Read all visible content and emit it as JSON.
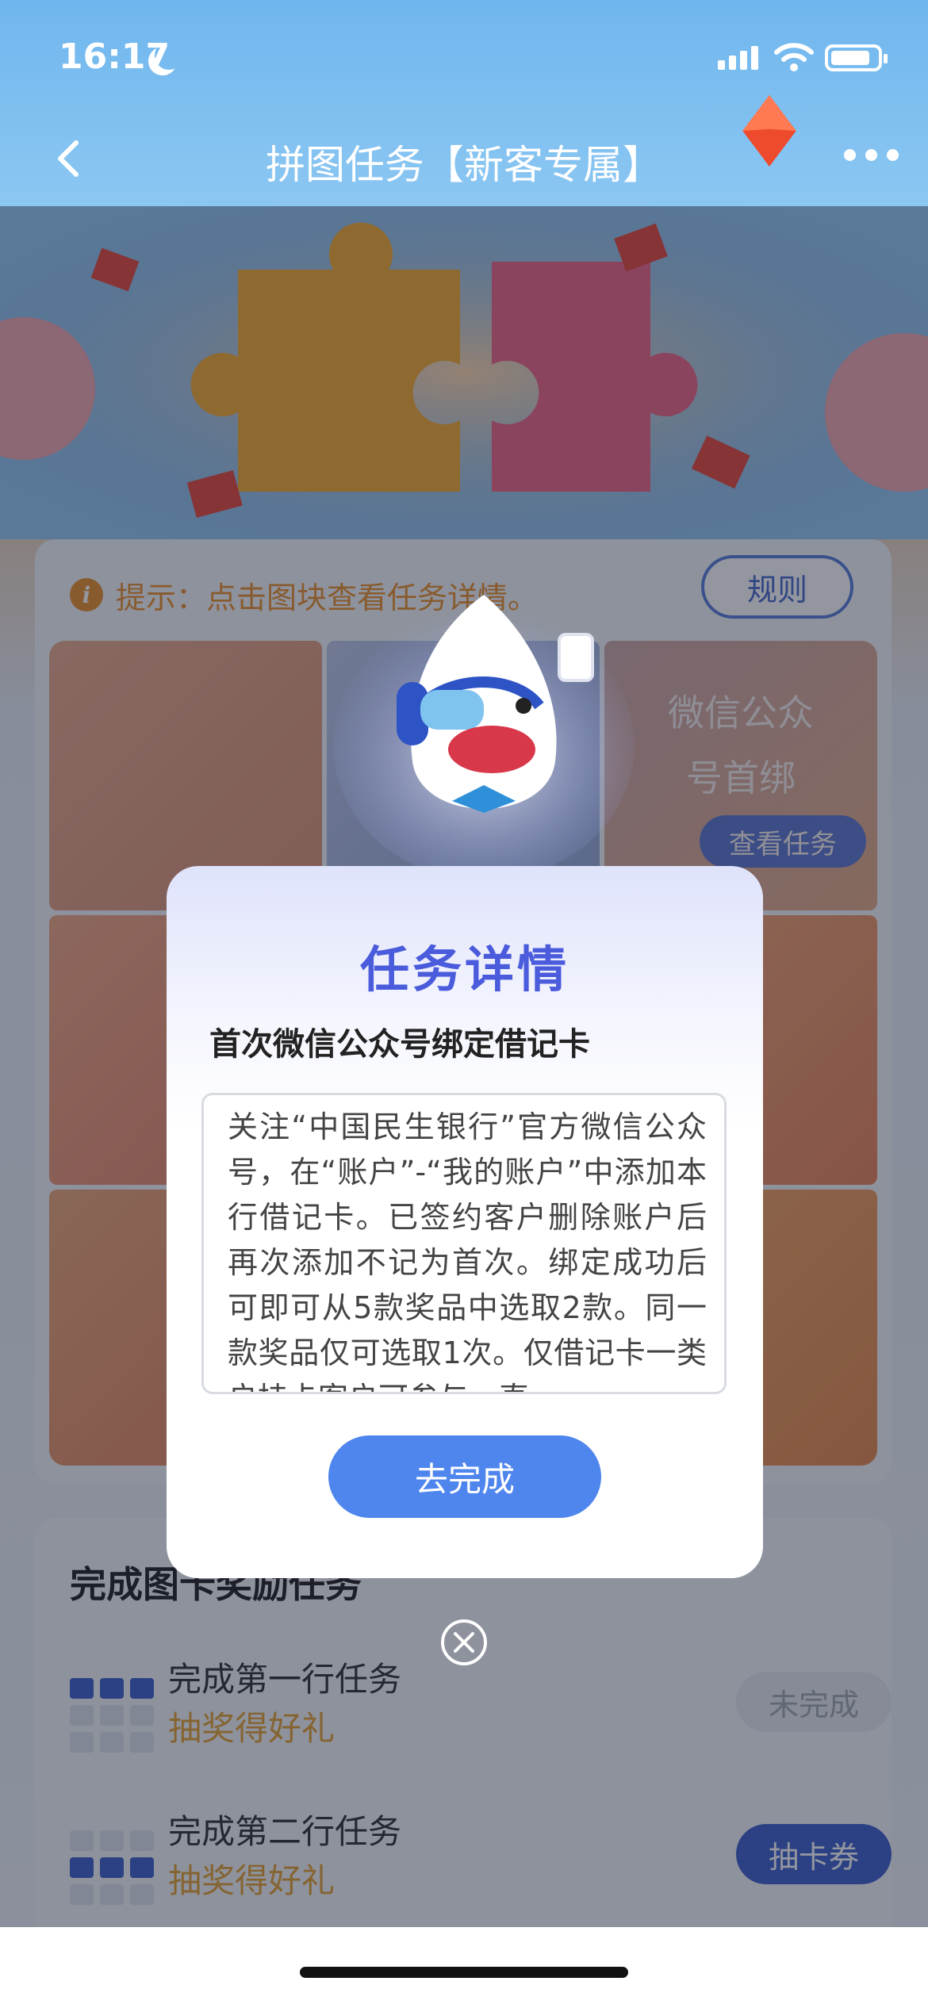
{
  "status_bar": {
    "time": "16:17"
  },
  "nav": {
    "title": "拼图任务【新客专属】"
  },
  "tip": {
    "icon": "i",
    "text": "提示：点击图块查看任务详情。",
    "rules_label": "规则"
  },
  "puzzle_grid": {
    "tile_title_line1": "微信公众",
    "tile_title_line2": "号首绑",
    "view_task_label": "查看任务"
  },
  "reward_section": {
    "title": "完成图卡奖励任务",
    "tasks": [
      {
        "name": "完成第一行任务",
        "reward": "抽奖得好礼",
        "button": "未完成"
      },
      {
        "name": "完成第二行任务",
        "reward": "抽奖得好礼",
        "button": "抽卡券"
      }
    ]
  },
  "modal": {
    "title": "任务详情",
    "subtitle": "首次微信公众号绑定借记卡",
    "description": "关注“中国民生银行”官方微信公众号，在“账户”-“我的账户”中添加本行借记卡。已签约客户删除账户后再次添加不记为首次。绑定成功后可即可从5款奖品中选取2款。同一款奖品仅可选取1次。仅借记卡一类户持卡客户可参与，直",
    "button": "去完成"
  },
  "colors": {
    "accent": "#4f86ee",
    "title_blue": "#4a5bdc",
    "reward_orange": "#e39a22",
    "tip_orange": "#e8891d"
  }
}
